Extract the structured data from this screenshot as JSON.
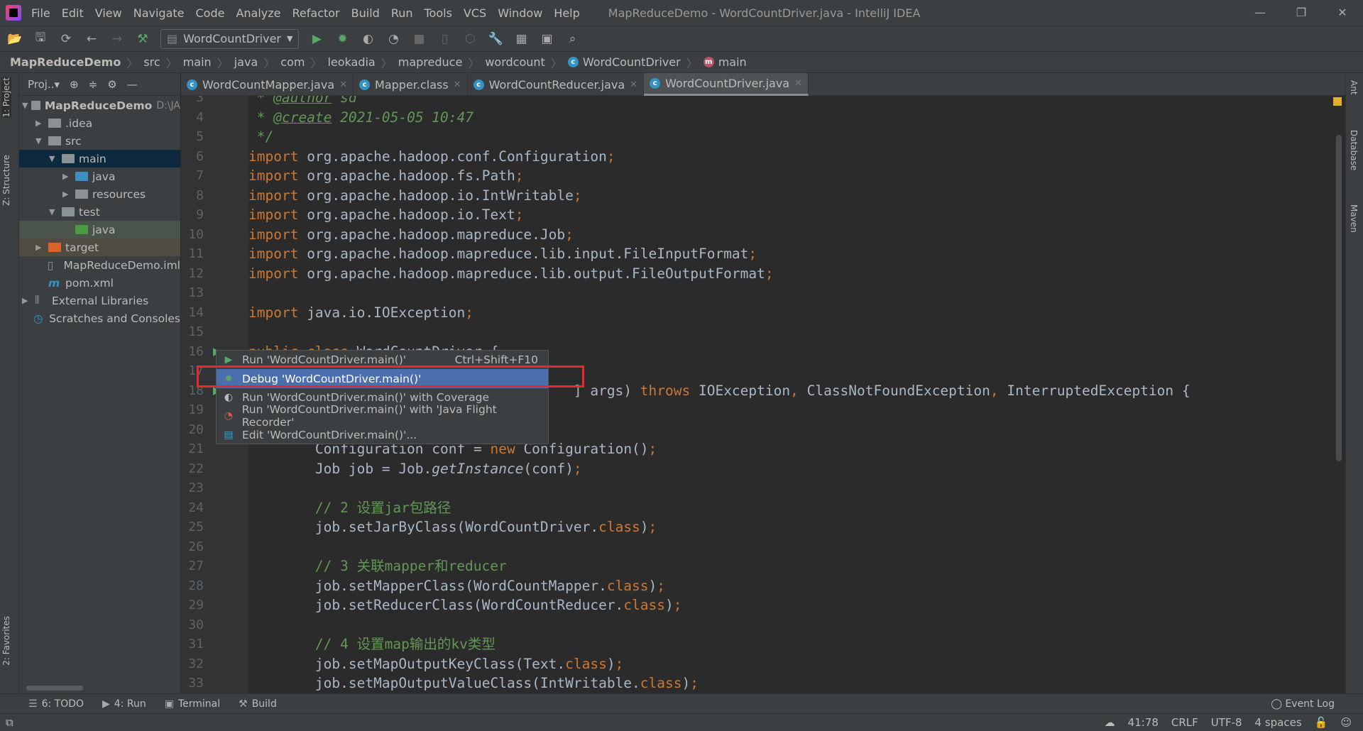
{
  "app": {
    "title": "MapReduceDemo - WordCountDriver.java - IntelliJ IDEA",
    "menus": [
      "File",
      "Edit",
      "View",
      "Navigate",
      "Code",
      "Analyze",
      "Refactor",
      "Build",
      "Run",
      "Tools",
      "VCS",
      "Window",
      "Help"
    ],
    "window_buttons": [
      "—",
      "❐",
      "✕"
    ]
  },
  "toolbar": {
    "run_config": "WordCountDriver"
  },
  "breadcrumb": [
    "MapReduceDemo",
    "src",
    "main",
    "java",
    "com",
    "leokadia",
    "mapreduce",
    "wordcount",
    "WordCountDriver",
    "main"
  ],
  "left_stripe": {
    "project": "1: Project",
    "structure": "Z: Structure",
    "favorites": "2: Favorites"
  },
  "right_stripe": {
    "ant": "Ant",
    "database": "Database",
    "maven": "Maven"
  },
  "project": {
    "header": "Proj..▾",
    "tree": [
      {
        "label": "MapReduceDemo",
        "suffix": "D:\\JA",
        "depth": 0,
        "arrow": "▼",
        "icon": "module-folder",
        "bold": true
      },
      {
        "label": ".idea",
        "depth": 1,
        "arrow": "▶",
        "icon": "folder"
      },
      {
        "label": "src",
        "depth": 1,
        "arrow": "▼",
        "icon": "folder"
      },
      {
        "label": "main",
        "depth": 2,
        "arrow": "▼",
        "icon": "folder",
        "state": "selected"
      },
      {
        "label": "java",
        "depth": 3,
        "arrow": "▶",
        "icon": "source-folder"
      },
      {
        "label": "resources",
        "depth": 3,
        "arrow": "▶",
        "icon": "resources-folder"
      },
      {
        "label": "test",
        "depth": 2,
        "arrow": "▼",
        "icon": "folder"
      },
      {
        "label": "java",
        "depth": 3,
        "arrow": "",
        "icon": "test-folder",
        "state": "test"
      },
      {
        "label": "target",
        "depth": 1,
        "arrow": "▶",
        "icon": "excluded-folder",
        "state": "excluded"
      },
      {
        "label": "MapReduceDemo.iml",
        "depth": 1,
        "arrow": "",
        "icon": "file"
      },
      {
        "label": "pom.xml",
        "depth": 1,
        "arrow": "",
        "icon": "maven"
      },
      {
        "label": "External Libraries",
        "depth": 0,
        "arrow": "▶",
        "icon": "library"
      },
      {
        "label": "Scratches and Consoles",
        "depth": 0,
        "arrow": "",
        "icon": "scratches"
      }
    ]
  },
  "tabs": [
    {
      "label": "WordCountMapper.java"
    },
    {
      "label": "Mapper.class"
    },
    {
      "label": "WordCountReducer.java"
    },
    {
      "label": "WordCountDriver.java",
      "active": true
    }
  ],
  "code": [
    {
      "n": "3",
      "t": [
        [
          " * ",
          "jd"
        ],
        [
          "@author",
          "tag"
        ],
        [
          " sd",
          "jd"
        ]
      ]
    },
    {
      "n": "4",
      "t": [
        [
          " * ",
          "jd"
        ],
        [
          "@create",
          "tag"
        ],
        [
          " 2021-05-05 10:47",
          "jd"
        ]
      ]
    },
    {
      "n": "5",
      "t": [
        [
          " */",
          "jd"
        ]
      ]
    },
    {
      "n": "6",
      "t": [
        [
          "import ",
          "kw"
        ],
        [
          "org.apache.hadoop.conf.Configuration",
          ""
        ],
        [
          ";",
          "kw"
        ]
      ]
    },
    {
      "n": "7",
      "t": [
        [
          "import ",
          "kw"
        ],
        [
          "org.apache.hadoop.fs.Path",
          ""
        ],
        [
          ";",
          "kw"
        ]
      ]
    },
    {
      "n": "8",
      "t": [
        [
          "import ",
          "kw"
        ],
        [
          "org.apache.hadoop.io.IntWritable",
          ""
        ],
        [
          ";",
          "kw"
        ]
      ]
    },
    {
      "n": "9",
      "t": [
        [
          "import ",
          "kw"
        ],
        [
          "org.apache.hadoop.io.Text",
          ""
        ],
        [
          ";",
          "kw"
        ]
      ]
    },
    {
      "n": "10",
      "t": [
        [
          "import ",
          "kw"
        ],
        [
          "org.apache.hadoop.mapreduce.Job",
          ""
        ],
        [
          ";",
          "kw"
        ]
      ]
    },
    {
      "n": "11",
      "t": [
        [
          "import ",
          "kw"
        ],
        [
          "org.apache.hadoop.mapreduce.lib.input.FileInputFormat",
          ""
        ],
        [
          ";",
          "kw"
        ]
      ]
    },
    {
      "n": "12",
      "t": [
        [
          "import ",
          "kw"
        ],
        [
          "org.apache.hadoop.mapreduce.lib.output.FileOutputFormat",
          ""
        ],
        [
          ";",
          "kw"
        ]
      ]
    },
    {
      "n": "13",
      "t": []
    },
    {
      "n": "14",
      "t": [
        [
          "import ",
          "kw"
        ],
        [
          "java.io.IOException",
          ""
        ],
        [
          ";",
          "kw"
        ]
      ]
    },
    {
      "n": "15",
      "t": []
    },
    {
      "n": "16",
      "t": [
        [
          "public class ",
          "kw"
        ],
        [
          "WordCountDriver {",
          ""
        ]
      ]
    },
    {
      "n": "17",
      "t": []
    },
    {
      "n": "18",
      "t": [
        [
          "                                       ] args) ",
          ""
        ],
        [
          "throws ",
          "kw"
        ],
        [
          "IOException",
          ""
        ],
        [
          ", ",
          "kw"
        ],
        [
          "ClassNotFoundException",
          ""
        ],
        [
          ", ",
          "kw"
        ],
        [
          "InterruptedException {",
          ""
        ]
      ]
    },
    {
      "n": "19",
      "t": []
    },
    {
      "n": "20",
      "t": []
    },
    {
      "n": "21",
      "t": [
        [
          "        Configuration conf = ",
          ""
        ],
        [
          "new ",
          "kw"
        ],
        [
          "Configuration()",
          ""
        ],
        [
          ";",
          "kw"
        ]
      ]
    },
    {
      "n": "22",
      "t": [
        [
          "        Job job = Job.",
          ""
        ],
        [
          "getInstance",
          "it"
        ],
        [
          "(conf)",
          ""
        ],
        [
          ";",
          "kw"
        ]
      ]
    },
    {
      "n": "23",
      "t": []
    },
    {
      "n": "24",
      "t": [
        [
          "        // 2 设置jar包路径",
          "cm"
        ]
      ]
    },
    {
      "n": "25",
      "t": [
        [
          "        job.setJarByClass(WordCountDriver.",
          ""
        ],
        [
          "class",
          "kw"
        ],
        [
          ")",
          ""
        ],
        [
          ";",
          "kw"
        ]
      ]
    },
    {
      "n": "26",
      "t": []
    },
    {
      "n": "27",
      "t": [
        [
          "        // 3 关联mapper和reducer",
          "cm"
        ]
      ]
    },
    {
      "n": "28",
      "t": [
        [
          "        job.setMapperClass(WordCountMapper.",
          ""
        ],
        [
          "class",
          "kw"
        ],
        [
          ")",
          ""
        ],
        [
          ";",
          "kw"
        ]
      ]
    },
    {
      "n": "29",
      "t": [
        [
          "        job.setReducerClass(WordCountReducer.",
          ""
        ],
        [
          "class",
          "kw"
        ],
        [
          ")",
          ""
        ],
        [
          ";",
          "kw"
        ]
      ]
    },
    {
      "n": "30",
      "t": []
    },
    {
      "n": "31",
      "t": [
        [
          "        // 4 设置map输出的kv类型",
          "cm"
        ]
      ]
    },
    {
      "n": "32",
      "t": [
        [
          "        job.setMapOutputKeyClass(Text.",
          ""
        ],
        [
          "class",
          "kw"
        ],
        [
          ")",
          ""
        ],
        [
          ";",
          "kw"
        ]
      ]
    },
    {
      "n": "33",
      "t": [
        [
          "        job.setMapOutputValueClass(IntWritable.",
          ""
        ],
        [
          "class",
          "kw"
        ],
        [
          ")",
          ""
        ],
        [
          ";",
          "kw"
        ]
      ]
    }
  ],
  "popup": {
    "items": [
      {
        "label": "Run 'WordCountDriver.main()'",
        "shortcut": "Ctrl+Shift+F10",
        "icon": "run-icon"
      },
      {
        "label": "Debug 'WordCountDriver.main()'",
        "shortcut": "",
        "icon": "debug-icon",
        "selected": true
      },
      {
        "label": "Run 'WordCountDriver.main()' with Coverage",
        "shortcut": "",
        "icon": "coverage-icon"
      },
      {
        "label": "Run 'WordCountDriver.main()' with 'Java Flight Recorder'",
        "shortcut": "",
        "icon": "profiler-icon"
      },
      {
        "label": "Edit 'WordCountDriver.main()'...",
        "shortcut": "",
        "icon": "edit-config-icon"
      }
    ]
  },
  "toolwindows": [
    {
      "label": "6: TODO",
      "icon": "☰"
    },
    {
      "label": "4: Run",
      "icon": "▶"
    },
    {
      "label": "Terminal",
      "icon": "▣"
    },
    {
      "label": "Build",
      "icon": "⚒"
    }
  ],
  "event_log": "Event Log",
  "status": {
    "position": "41:78",
    "line_sep": "CRLF",
    "encoding": "UTF-8",
    "indent": "4 spaces"
  },
  "colors": {
    "keyword": "#cc7832",
    "comment": "#629755",
    "text": "#a9b7c6",
    "selection": "#4b6eaf",
    "highlight_box": "#e8282e"
  }
}
